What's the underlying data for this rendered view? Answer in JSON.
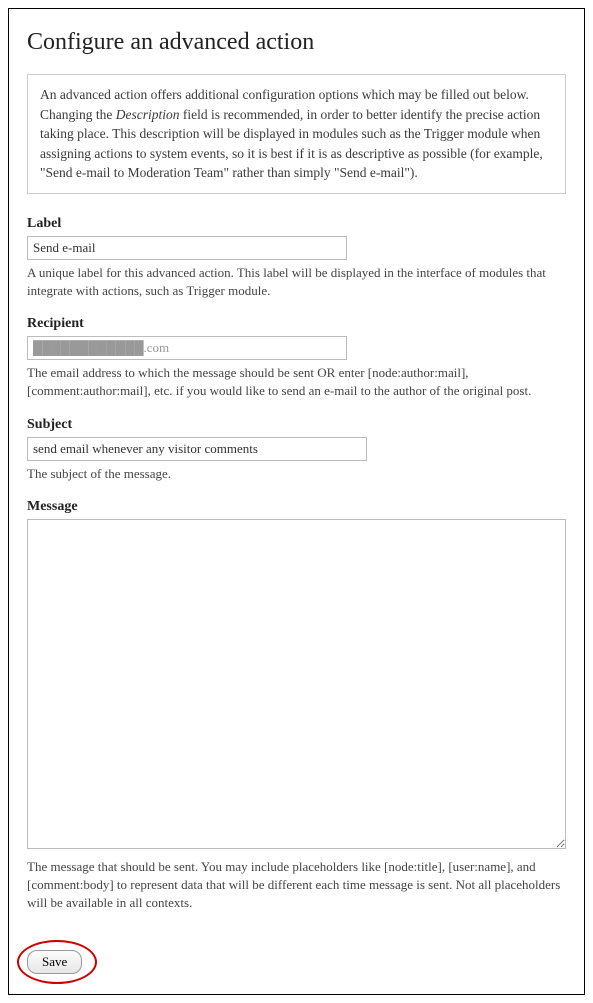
{
  "page_title": "Configure an advanced action",
  "intro_html": "An advanced action offers additional configuration options which may be filled out below. Changing the <em>Description</em> field is recommended, in order to better identify the precise action taking place. This description will be displayed in modules such as the Trigger module when assigning actions to system events, so it is best if it is as descriptive as possible (for example, \"Send e-mail to Moderation Team\" rather than simply \"Send e-mail\").",
  "fields": {
    "label": {
      "label": "Label",
      "value": "Send e-mail",
      "help": "A unique label for this advanced action. This label will be displayed in the interface of modules that integrate with actions, such as Trigger module."
    },
    "recipient": {
      "label": "Recipient",
      "value": "████████████.com",
      "help": "The email address to which the message should be sent OR enter [node:author:mail], [comment:author:mail], etc. if you would like to send an e-mail to the author of the original post."
    },
    "subject": {
      "label": "Subject",
      "value": "send email whenever any visitor comments",
      "help": "The subject of the message."
    },
    "message": {
      "label": "Message",
      "value": "",
      "help": "The message that should be sent. You may include placeholders like [node:title], [user:name], and [comment:body] to represent data that will be different each time message is sent. Not all placeholders will be available in all contexts."
    }
  },
  "buttons": {
    "save": "Save"
  }
}
